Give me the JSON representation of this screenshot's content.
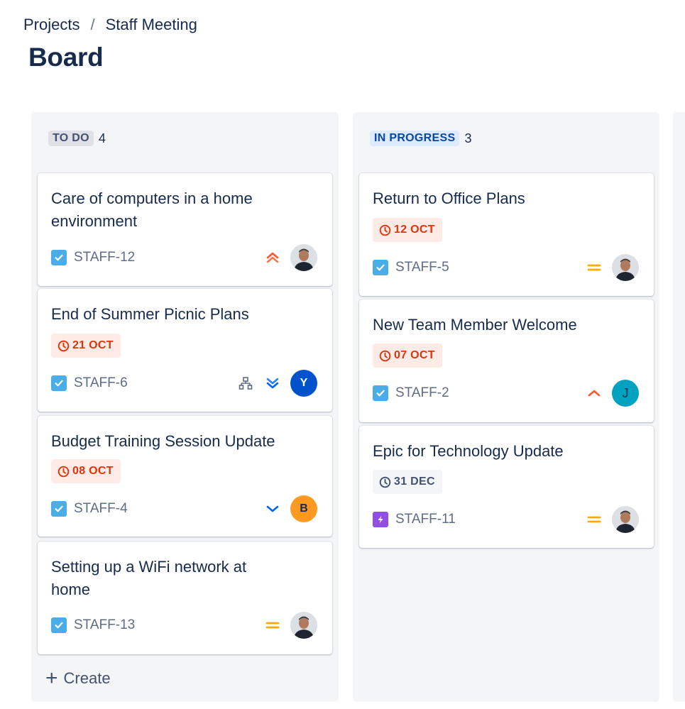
{
  "breadcrumb": {
    "projects": "Projects",
    "separator": "/",
    "project": "Staff Meeting"
  },
  "page_title": "Board",
  "columns": [
    {
      "status": "TO DO",
      "count": "4",
      "create_label": "Create",
      "cards": [
        {
          "title": "Care of computers in a home environment",
          "key": "STAFF-12",
          "type": "task",
          "priority": "highest",
          "assignee": "photo"
        },
        {
          "title": "End of Summer Picnic Plans",
          "due": "21 OCT",
          "key": "STAFF-6",
          "type": "task",
          "priority": "lowest",
          "has_child_icon": true,
          "assignee": "Y",
          "assignee_color": "#0052cc"
        },
        {
          "title": "Budget Training Session Update",
          "due": "08 OCT",
          "key": "STAFF-4",
          "type": "task",
          "priority": "low",
          "assignee": "B",
          "assignee_color": "#ff991f"
        },
        {
          "title": "Setting up a WiFi network at home",
          "key": "STAFF-13",
          "type": "task",
          "priority": "medium",
          "assignee": "photo"
        }
      ]
    },
    {
      "status": "IN PROGRESS",
      "count": "3",
      "cards": [
        {
          "title": "Return to Office Plans",
          "due": "12 OCT",
          "key": "STAFF-5",
          "type": "task",
          "priority": "medium",
          "assignee": "photo"
        },
        {
          "title": "New Team Member Welcome",
          "due": "07 OCT",
          "key": "STAFF-2",
          "type": "task",
          "priority": "high",
          "assignee": "J",
          "assignee_color": "#00a3bf"
        },
        {
          "title": "Epic for Technology Update",
          "due": "31 DEC",
          "due_style": "normal",
          "key": "STAFF-11",
          "type": "epic",
          "priority": "medium",
          "assignee": "photo"
        }
      ]
    }
  ],
  "colors": {
    "overdue": "#de350b",
    "task_icon": "#4bade8",
    "epic_icon": "#904ee2",
    "priority_medium": "#ffab00",
    "priority_high": "#ff5630",
    "priority_low": "#0065ff"
  }
}
